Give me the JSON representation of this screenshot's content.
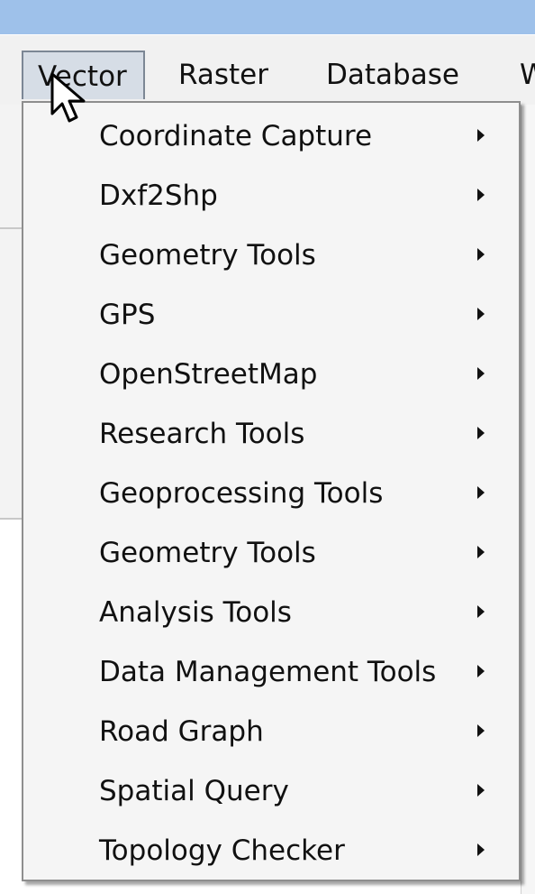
{
  "menubar": {
    "items": [
      {
        "label": "Vector",
        "active": true
      },
      {
        "label": "Raster",
        "active": false
      },
      {
        "label": "Database",
        "active": false
      },
      {
        "label": "W",
        "active": false
      }
    ]
  },
  "vector_menu": {
    "items": [
      {
        "label": "Coordinate Capture",
        "has_submenu": true
      },
      {
        "label": "Dxf2Shp",
        "has_submenu": true
      },
      {
        "label": "Geometry Tools",
        "has_submenu": true
      },
      {
        "label": "GPS",
        "has_submenu": true
      },
      {
        "label": "OpenStreetMap",
        "has_submenu": true
      },
      {
        "label": "Research Tools",
        "has_submenu": true
      },
      {
        "label": "Geoprocessing Tools",
        "has_submenu": true
      },
      {
        "label": "Geometry Tools",
        "has_submenu": true
      },
      {
        "label": "Analysis Tools",
        "has_submenu": true
      },
      {
        "label": "Data Management Tools",
        "has_submenu": true
      },
      {
        "label": "Road Graph",
        "has_submenu": true
      },
      {
        "label": "Spatial Query",
        "has_submenu": true
      },
      {
        "label": "Topology Checker",
        "has_submenu": true
      }
    ]
  },
  "colors": {
    "titlebar": "#9ec1ea",
    "menu_background": "#f5f5f5",
    "active_menubar_item": "#d6dde6"
  }
}
